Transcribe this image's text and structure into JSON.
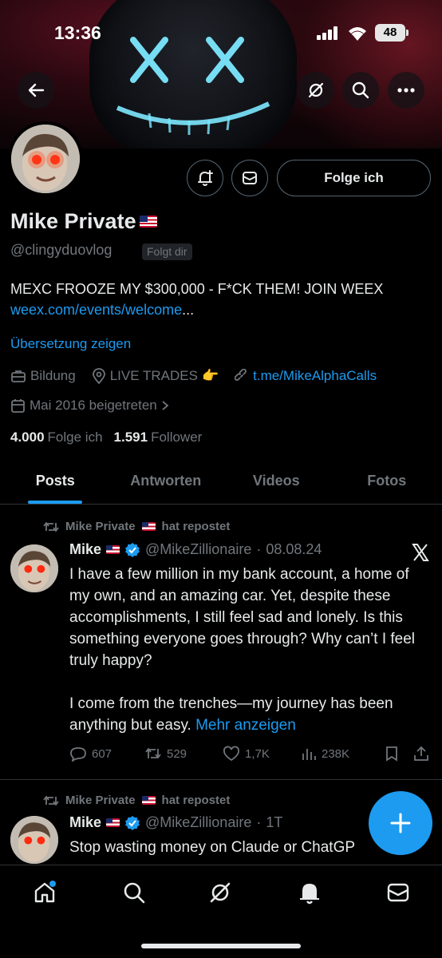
{
  "status_bar": {
    "time": "13:36",
    "battery": "48"
  },
  "profile": {
    "name": "Mike Private",
    "handle": "@clingyduovlog",
    "follows_you": "Folgt dir",
    "follow_button": "Folge ich",
    "bio_text": "MEXC FROOZE MY $300,000 - F*CK THEM! JOIN WEEX ",
    "bio_link": "weex.com/events/welcome",
    "bio_ellipsis": "...",
    "translate": "Übersetzung zeigen",
    "category": "Bildung",
    "location": "LIVE TRADES",
    "location_emoji": "👉",
    "website": "t.me/MikeAlphaCalls",
    "joined": "Mai 2016 beigetreten",
    "following_count": "4.000",
    "following_label": "Folge ich",
    "followers_count": "1.591",
    "followers_label": "Follower"
  },
  "tabs": [
    {
      "label": "Posts",
      "active": true
    },
    {
      "label": "Antworten"
    },
    {
      "label": "Videos"
    },
    {
      "label": "Fotos"
    }
  ],
  "posts": [
    {
      "repost_by": "Mike Private",
      "repost_suffix": "hat repostet",
      "author": "Mike",
      "handle": "@MikeZillionaire",
      "separator": "·",
      "date": "08.08.24",
      "text_p1": "I have a few million in my bank account, a home of my own, and an amazing car. Yet, despite these accomplishments, I still feel sad and lonely. Is this something everyone goes through? Why can’t I feel truly happy?",
      "text_p2": "I come from the trenches—my journey has been anything but easy. ",
      "more": "Mehr anzeigen",
      "replies": "607",
      "reposts": "529",
      "likes": "1,7K",
      "views": "238K"
    },
    {
      "repost_by": "Mike Private",
      "repost_suffix": "hat repostet",
      "author": "Mike",
      "handle": "@MikeZillionaire",
      "separator": "·",
      "date": "1T",
      "text_p1": "Stop wasting money on Claude or ChatGP"
    }
  ],
  "colors": {
    "accent": "#1d9bf0",
    "background": "#000000",
    "muted": "#71767b",
    "text": "#e7e9ea"
  }
}
